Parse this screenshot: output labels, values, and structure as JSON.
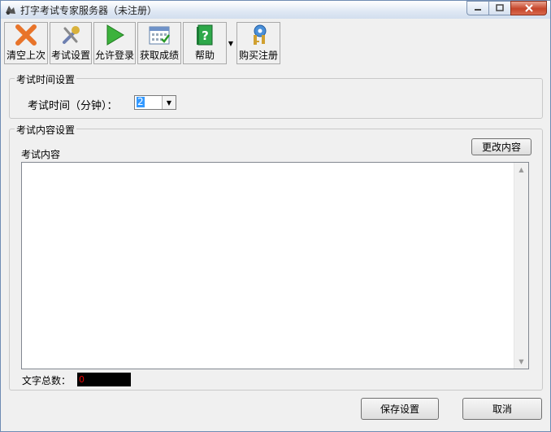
{
  "window": {
    "title": "打字考试专家服务器（未注册）"
  },
  "toolbar": {
    "buttons": [
      {
        "label": "清空上次",
        "icon": "clear-x-icon"
      },
      {
        "label": "考试设置",
        "icon": "tools-icon"
      },
      {
        "label": "允许登录",
        "icon": "play-icon"
      },
      {
        "label": "获取成绩",
        "icon": "calendar-icon"
      },
      {
        "label": "帮助",
        "icon": "help-book-icon"
      },
      {
        "label": "购买注册",
        "icon": "keys-icon"
      }
    ]
  },
  "time_group": {
    "title": "考试时间设置",
    "label": "考试时间（分钟）：",
    "value": "2"
  },
  "content_group": {
    "title": "考试内容设置",
    "content_label": "考试内容",
    "change_button": "更改内容",
    "text": ""
  },
  "footer": {
    "count_label": "文字总数：",
    "count_value": "0",
    "save_button": "保存设置",
    "cancel_button": "取消"
  },
  "colors": {
    "title_bg": "#dfe8f4",
    "close_red": "#c6452a",
    "count_bg": "#000000",
    "count_text": "#e00000"
  }
}
